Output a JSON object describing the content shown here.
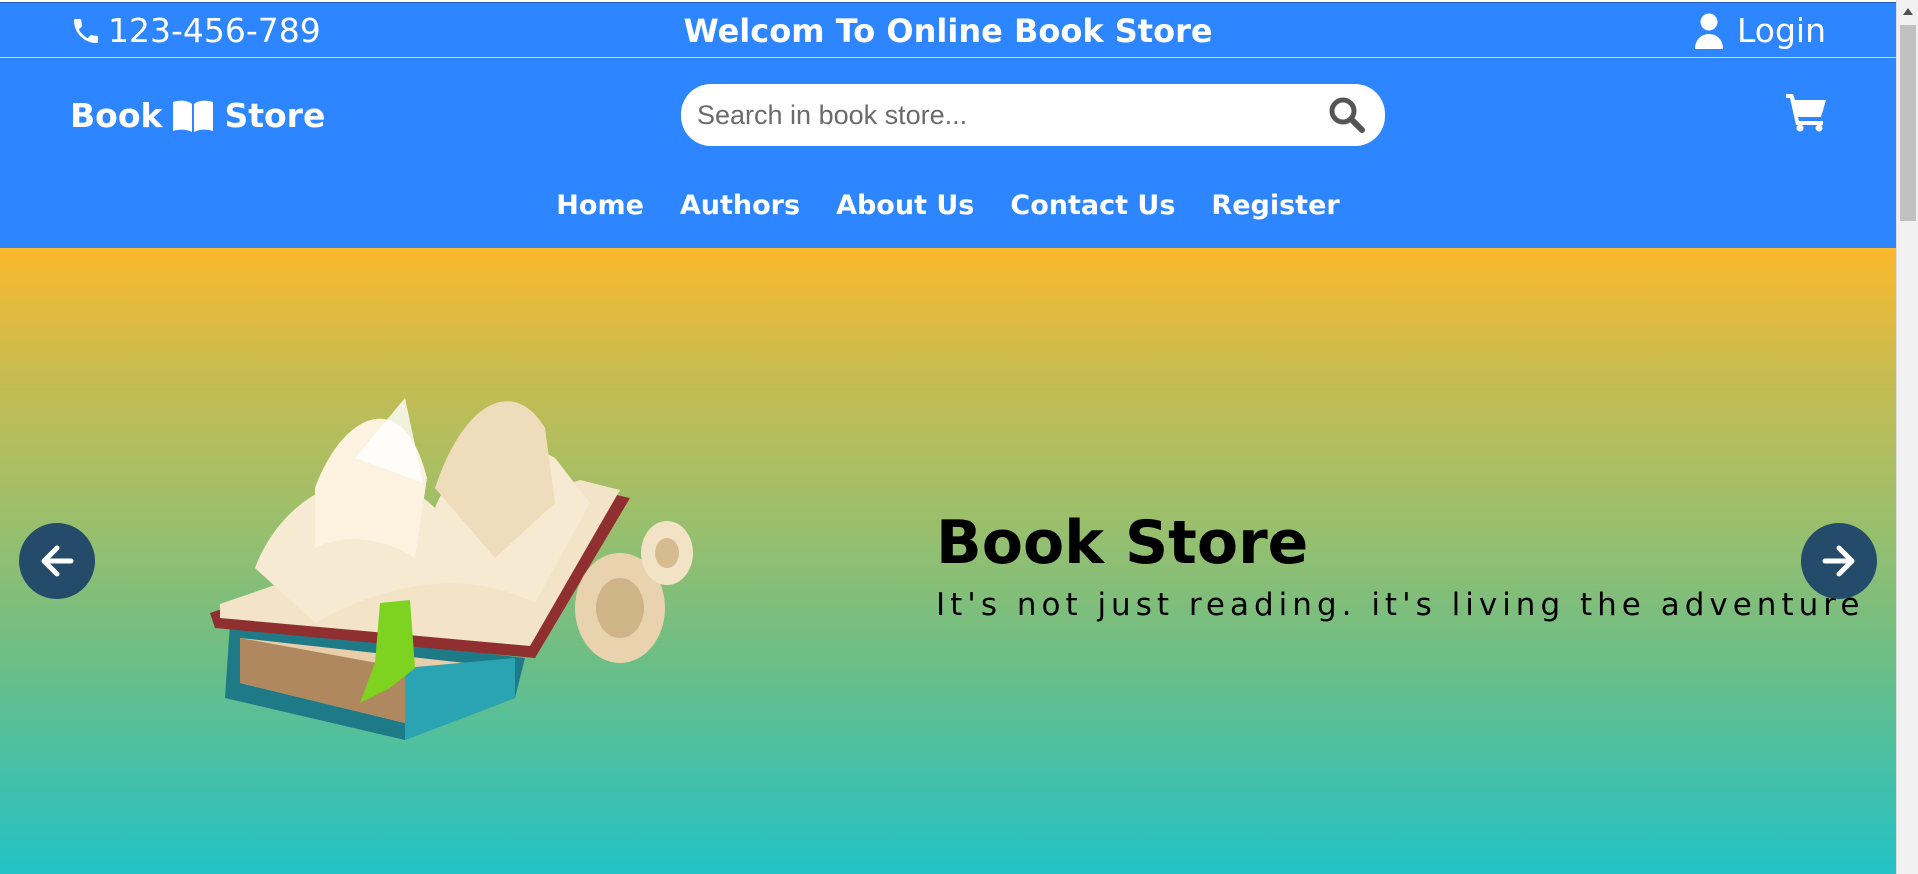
{
  "theme": {
    "primary": "#2d86ff",
    "arrow_bg": "#254b6a",
    "text_dark": "#000000"
  },
  "top_bar": {
    "phone_icon": "phone-icon",
    "phone": "123-456-789",
    "welcome": "Welcom To Online Book Store",
    "login_icon": "user-icon",
    "login_label": "Login"
  },
  "header": {
    "logo_left": "Book",
    "logo_icon": "open-book-icon",
    "logo_right": "Store",
    "search": {
      "placeholder": "Search in book store...",
      "value": "",
      "icon": "search-icon"
    },
    "cart_icon": "cart-icon"
  },
  "nav": {
    "items": [
      {
        "label": "Home"
      },
      {
        "label": "Authors"
      },
      {
        "label": "About Us"
      },
      {
        "label": "Contact Us"
      },
      {
        "label": "Register"
      }
    ]
  },
  "hero": {
    "title": "Book Store",
    "subtitle": "It's not just reading. it's living the adventure",
    "illustration": "books-illustration",
    "prev_icon": "arrow-left-icon",
    "next_icon": "arrow-right-icon"
  }
}
